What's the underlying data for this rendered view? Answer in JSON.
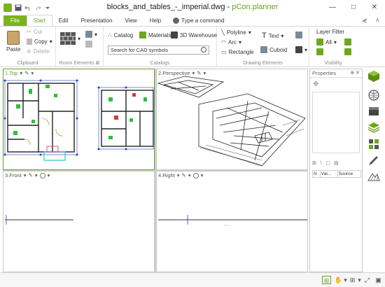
{
  "window": {
    "file_name": "blocks_and_tables_-_imperial.dwg",
    "separator": " - ",
    "app_name": "pCon.planner",
    "controls": [
      "—",
      "□",
      "✕"
    ]
  },
  "tabs": {
    "file": "File",
    "start": "Start",
    "edit": "Edit",
    "presentation": "Presentation",
    "view": "View",
    "help": "Help"
  },
  "command": {
    "placeholder": "Type a command"
  },
  "ribbon": {
    "clipboard": {
      "label": "Clipboard",
      "paste": "Paste",
      "cut": "Cut",
      "copy": "Copy",
      "delete": "Delete"
    },
    "room_elements": {
      "label": "Room Elements"
    },
    "catalogs": {
      "label": "Catalogs",
      "catalog": "Catalog",
      "materials": "Materials",
      "warehouse": "3D Warehouse",
      "search_placeholder": "Search for CAD symbols"
    },
    "drawing": {
      "label": "Drawing Elements",
      "polyline": "Polyline",
      "arc": "Arc",
      "rectangle": "Rectangle",
      "text": "Text",
      "cuboid": "Cuboid"
    },
    "visibility": {
      "label": "Visibility",
      "layer_filter": "Layer Filter",
      "all": "All"
    }
  },
  "viewports": {
    "top": "1.Top",
    "perspective": "2.Perspective",
    "front": "3.Front",
    "right": "4.Right"
  },
  "properties": {
    "title": "Properties",
    "columns": [
      "N",
      "Val...",
      "Source"
    ]
  },
  "colors": {
    "brand_green": "#7bb31a",
    "accent_text": "#6a9f1c"
  }
}
